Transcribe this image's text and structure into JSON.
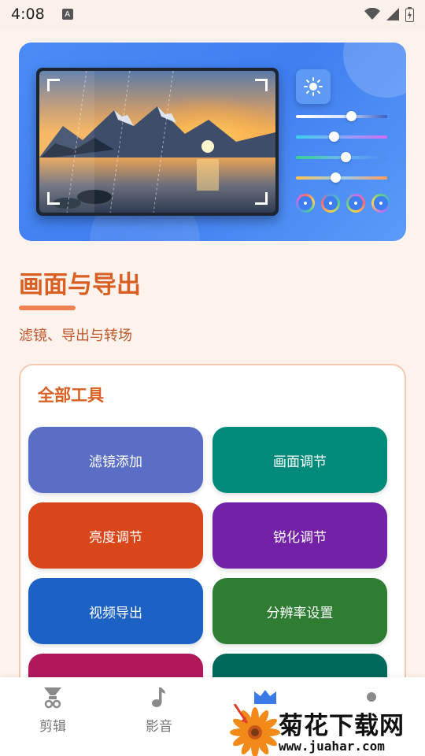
{
  "status_bar": {
    "time": "4:08",
    "notification_letter": "A"
  },
  "page": {
    "title": "画面与导出",
    "subtitle": "滤镜、导出与转场"
  },
  "tools": {
    "title": "全部工具",
    "buttons": [
      {
        "label": "滤镜添加",
        "color": "#5b6ec6"
      },
      {
        "label": "画面调节",
        "color": "#008a7a"
      },
      {
        "label": "亮度调节",
        "color": "#d84619"
      },
      {
        "label": "锐化调节",
        "color": "#7321a6"
      },
      {
        "label": "视频导出",
        "color": "#1c62c4"
      },
      {
        "label": "分辨率设置",
        "color": "#2e7d32"
      },
      {
        "label": "",
        "color": "#b0185c"
      },
      {
        "label": "",
        "color": "#00695c"
      }
    ]
  },
  "bottom_nav": {
    "items": [
      {
        "label": "剪辑",
        "icon": "scissors-icon"
      },
      {
        "label": "影音",
        "icon": "music-note-icon"
      },
      {
        "label": "",
        "icon": "film-icon"
      },
      {
        "label": "",
        "icon": "profile-icon"
      }
    ]
  },
  "watermark": {
    "title": "菊花下载网",
    "url": "www.juahar.com"
  },
  "colors": {
    "accent": "#d95f22",
    "hero_bg": "#4b8cf5",
    "page_bg": "#fdf3ec"
  }
}
